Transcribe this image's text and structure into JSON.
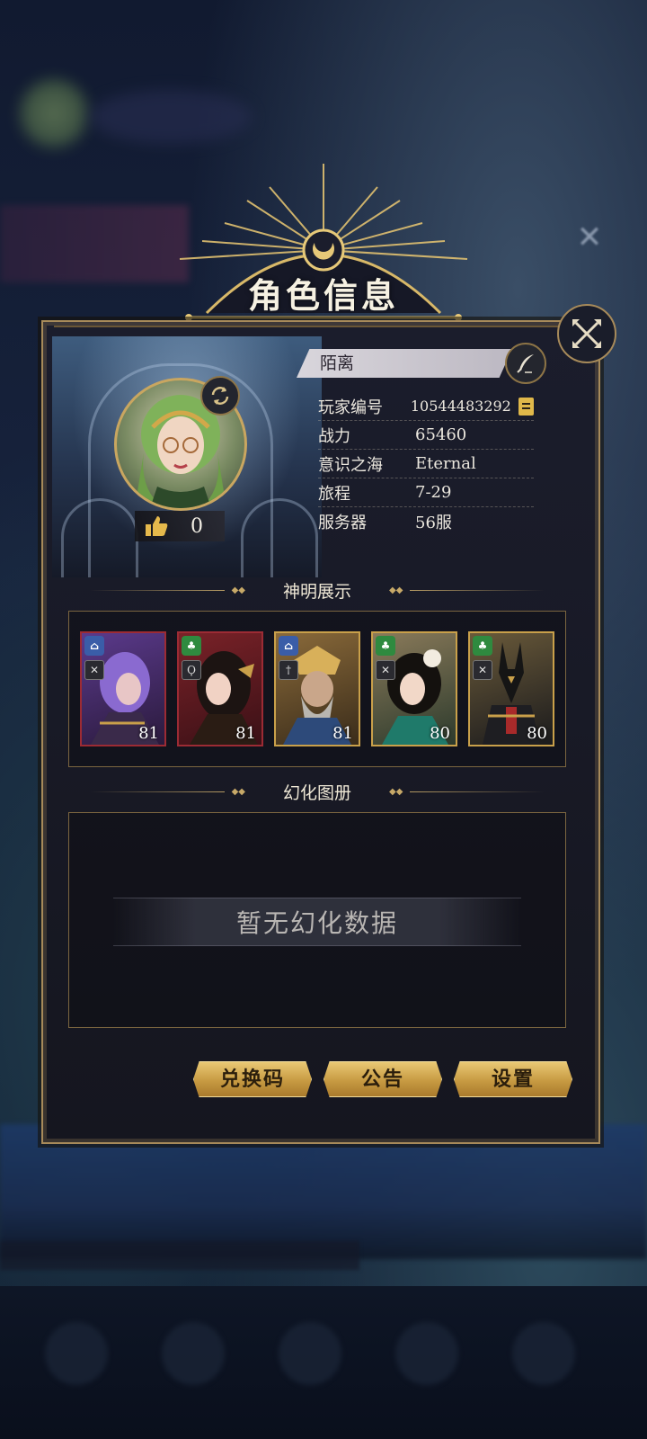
{
  "header": {
    "title": "角色信息"
  },
  "profile": {
    "name": "陌离",
    "likes": "0",
    "info": [
      {
        "label": "玩家编号",
        "value": "10544483292"
      },
      {
        "label": "战力",
        "value": "65460"
      },
      {
        "label": "意识之海",
        "value": "Eternal"
      },
      {
        "label": "旅程",
        "value": "7-29"
      },
      {
        "label": "服务器",
        "value": "56服"
      }
    ]
  },
  "gods_section": {
    "title": "神明展示",
    "cards": [
      {
        "level": "81",
        "frame": "#9c2b34",
        "badge_color": "#3a5da8",
        "art": "purple-haired god"
      },
      {
        "level": "81",
        "frame": "#9c2b34",
        "badge_color": "#2f8a3f",
        "art": "dark-haired goddess"
      },
      {
        "level": "81",
        "frame": "#c9a04a",
        "badge_color": "#3a5da8",
        "art": "bearded golden god"
      },
      {
        "level": "80",
        "frame": "#c9a04a",
        "badge_color": "#2f8a3f",
        "art": "goddess with white flowers"
      },
      {
        "level": "80",
        "frame": "#c9a04a",
        "badge_color": "#2f8a3f",
        "art": "jackal-headed god"
      }
    ]
  },
  "skins_section": {
    "title": "幻化图册",
    "empty_text": "暂无幻化数据"
  },
  "buttons": {
    "redeem": "兑换码",
    "notice": "公告",
    "settings": "设置"
  },
  "colors": {
    "gold": "#c9a660",
    "panel": "#1b1d2c",
    "accent_red": "#9c2b34"
  }
}
